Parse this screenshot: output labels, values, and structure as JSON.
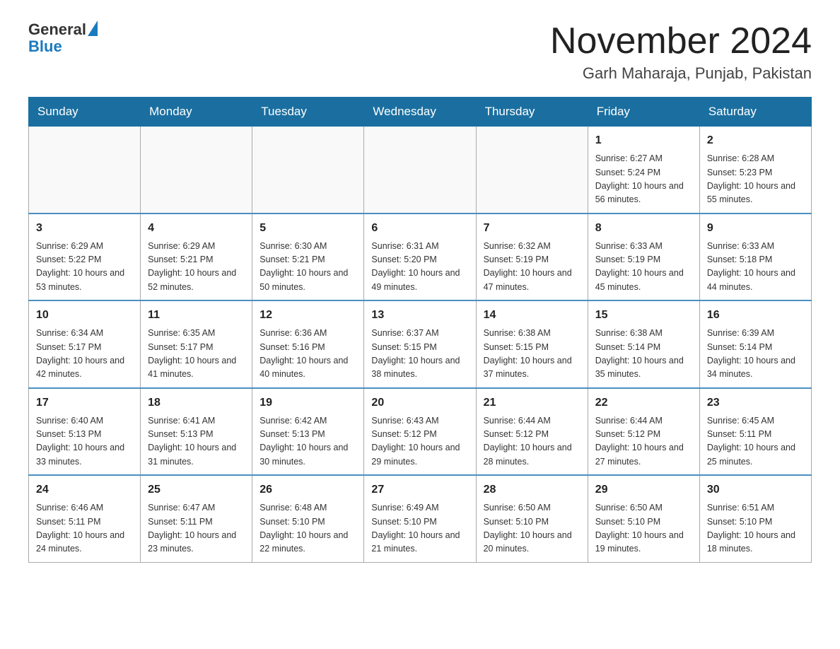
{
  "header": {
    "logo_general": "General",
    "logo_blue": "Blue",
    "main_title": "November 2024",
    "subtitle": "Garh Maharaja, Punjab, Pakistan"
  },
  "weekdays": [
    "Sunday",
    "Monday",
    "Tuesday",
    "Wednesday",
    "Thursday",
    "Friday",
    "Saturday"
  ],
  "weeks": [
    [
      {
        "day": "",
        "sunrise": "",
        "sunset": "",
        "daylight": ""
      },
      {
        "day": "",
        "sunrise": "",
        "sunset": "",
        "daylight": ""
      },
      {
        "day": "",
        "sunrise": "",
        "sunset": "",
        "daylight": ""
      },
      {
        "day": "",
        "sunrise": "",
        "sunset": "",
        "daylight": ""
      },
      {
        "day": "",
        "sunrise": "",
        "sunset": "",
        "daylight": ""
      },
      {
        "day": "1",
        "sunrise": "Sunrise: 6:27 AM",
        "sunset": "Sunset: 5:24 PM",
        "daylight": "Daylight: 10 hours and 56 minutes."
      },
      {
        "day": "2",
        "sunrise": "Sunrise: 6:28 AM",
        "sunset": "Sunset: 5:23 PM",
        "daylight": "Daylight: 10 hours and 55 minutes."
      }
    ],
    [
      {
        "day": "3",
        "sunrise": "Sunrise: 6:29 AM",
        "sunset": "Sunset: 5:22 PM",
        "daylight": "Daylight: 10 hours and 53 minutes."
      },
      {
        "day": "4",
        "sunrise": "Sunrise: 6:29 AM",
        "sunset": "Sunset: 5:21 PM",
        "daylight": "Daylight: 10 hours and 52 minutes."
      },
      {
        "day": "5",
        "sunrise": "Sunrise: 6:30 AM",
        "sunset": "Sunset: 5:21 PM",
        "daylight": "Daylight: 10 hours and 50 minutes."
      },
      {
        "day": "6",
        "sunrise": "Sunrise: 6:31 AM",
        "sunset": "Sunset: 5:20 PM",
        "daylight": "Daylight: 10 hours and 49 minutes."
      },
      {
        "day": "7",
        "sunrise": "Sunrise: 6:32 AM",
        "sunset": "Sunset: 5:19 PM",
        "daylight": "Daylight: 10 hours and 47 minutes."
      },
      {
        "day": "8",
        "sunrise": "Sunrise: 6:33 AM",
        "sunset": "Sunset: 5:19 PM",
        "daylight": "Daylight: 10 hours and 45 minutes."
      },
      {
        "day": "9",
        "sunrise": "Sunrise: 6:33 AM",
        "sunset": "Sunset: 5:18 PM",
        "daylight": "Daylight: 10 hours and 44 minutes."
      }
    ],
    [
      {
        "day": "10",
        "sunrise": "Sunrise: 6:34 AM",
        "sunset": "Sunset: 5:17 PM",
        "daylight": "Daylight: 10 hours and 42 minutes."
      },
      {
        "day": "11",
        "sunrise": "Sunrise: 6:35 AM",
        "sunset": "Sunset: 5:17 PM",
        "daylight": "Daylight: 10 hours and 41 minutes."
      },
      {
        "day": "12",
        "sunrise": "Sunrise: 6:36 AM",
        "sunset": "Sunset: 5:16 PM",
        "daylight": "Daylight: 10 hours and 40 minutes."
      },
      {
        "day": "13",
        "sunrise": "Sunrise: 6:37 AM",
        "sunset": "Sunset: 5:15 PM",
        "daylight": "Daylight: 10 hours and 38 minutes."
      },
      {
        "day": "14",
        "sunrise": "Sunrise: 6:38 AM",
        "sunset": "Sunset: 5:15 PM",
        "daylight": "Daylight: 10 hours and 37 minutes."
      },
      {
        "day": "15",
        "sunrise": "Sunrise: 6:38 AM",
        "sunset": "Sunset: 5:14 PM",
        "daylight": "Daylight: 10 hours and 35 minutes."
      },
      {
        "day": "16",
        "sunrise": "Sunrise: 6:39 AM",
        "sunset": "Sunset: 5:14 PM",
        "daylight": "Daylight: 10 hours and 34 minutes."
      }
    ],
    [
      {
        "day": "17",
        "sunrise": "Sunrise: 6:40 AM",
        "sunset": "Sunset: 5:13 PM",
        "daylight": "Daylight: 10 hours and 33 minutes."
      },
      {
        "day": "18",
        "sunrise": "Sunrise: 6:41 AM",
        "sunset": "Sunset: 5:13 PM",
        "daylight": "Daylight: 10 hours and 31 minutes."
      },
      {
        "day": "19",
        "sunrise": "Sunrise: 6:42 AM",
        "sunset": "Sunset: 5:13 PM",
        "daylight": "Daylight: 10 hours and 30 minutes."
      },
      {
        "day": "20",
        "sunrise": "Sunrise: 6:43 AM",
        "sunset": "Sunset: 5:12 PM",
        "daylight": "Daylight: 10 hours and 29 minutes."
      },
      {
        "day": "21",
        "sunrise": "Sunrise: 6:44 AM",
        "sunset": "Sunset: 5:12 PM",
        "daylight": "Daylight: 10 hours and 28 minutes."
      },
      {
        "day": "22",
        "sunrise": "Sunrise: 6:44 AM",
        "sunset": "Sunset: 5:12 PM",
        "daylight": "Daylight: 10 hours and 27 minutes."
      },
      {
        "day": "23",
        "sunrise": "Sunrise: 6:45 AM",
        "sunset": "Sunset: 5:11 PM",
        "daylight": "Daylight: 10 hours and 25 minutes."
      }
    ],
    [
      {
        "day": "24",
        "sunrise": "Sunrise: 6:46 AM",
        "sunset": "Sunset: 5:11 PM",
        "daylight": "Daylight: 10 hours and 24 minutes."
      },
      {
        "day": "25",
        "sunrise": "Sunrise: 6:47 AM",
        "sunset": "Sunset: 5:11 PM",
        "daylight": "Daylight: 10 hours and 23 minutes."
      },
      {
        "day": "26",
        "sunrise": "Sunrise: 6:48 AM",
        "sunset": "Sunset: 5:10 PM",
        "daylight": "Daylight: 10 hours and 22 minutes."
      },
      {
        "day": "27",
        "sunrise": "Sunrise: 6:49 AM",
        "sunset": "Sunset: 5:10 PM",
        "daylight": "Daylight: 10 hours and 21 minutes."
      },
      {
        "day": "28",
        "sunrise": "Sunrise: 6:50 AM",
        "sunset": "Sunset: 5:10 PM",
        "daylight": "Daylight: 10 hours and 20 minutes."
      },
      {
        "day": "29",
        "sunrise": "Sunrise: 6:50 AM",
        "sunset": "Sunset: 5:10 PM",
        "daylight": "Daylight: 10 hours and 19 minutes."
      },
      {
        "day": "30",
        "sunrise": "Sunrise: 6:51 AM",
        "sunset": "Sunset: 5:10 PM",
        "daylight": "Daylight: 10 hours and 18 minutes."
      }
    ]
  ]
}
